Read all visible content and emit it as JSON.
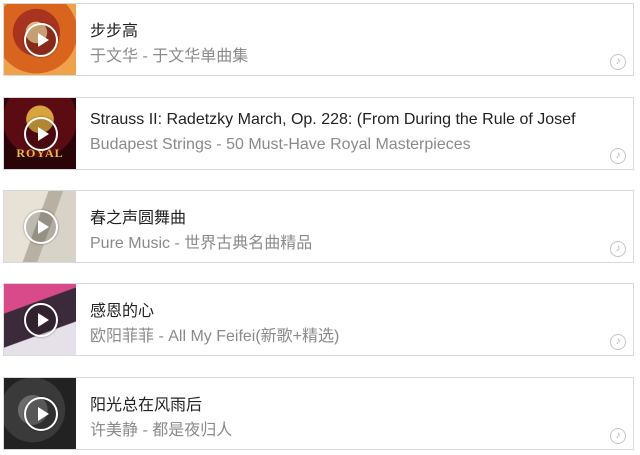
{
  "songs": [
    {
      "title": "步步高",
      "subtitle": "于文华 - 于文华单曲集",
      "art_icon": "album-art"
    },
    {
      "title": "Strauss II: Radetzky March, Op. 228: (From During the Rule of Josef",
      "subtitle": "Budapest Strings - 50 Must-Have Royal Masterpieces",
      "art_icon": "album-art",
      "art_text": "ROYAL"
    },
    {
      "title": "春之声圆舞曲",
      "subtitle": "Pure Music - 世界古典名曲精品",
      "art_icon": "album-art"
    },
    {
      "title": "感恩的心",
      "subtitle": "欧阳菲菲 - All My Feifei(新歌+精选)",
      "art_icon": "album-art"
    },
    {
      "title": "阳光总在风雨后",
      "subtitle": "许美静 - 都是夜归人",
      "art_icon": "album-art"
    }
  ],
  "icons": {
    "play": "play-icon",
    "music_note": "music-note-icon",
    "note_glyph": "♪"
  },
  "colors": {
    "title": "#222222",
    "subtitle": "#8a8a8a",
    "border": "#d9d9d9"
  }
}
